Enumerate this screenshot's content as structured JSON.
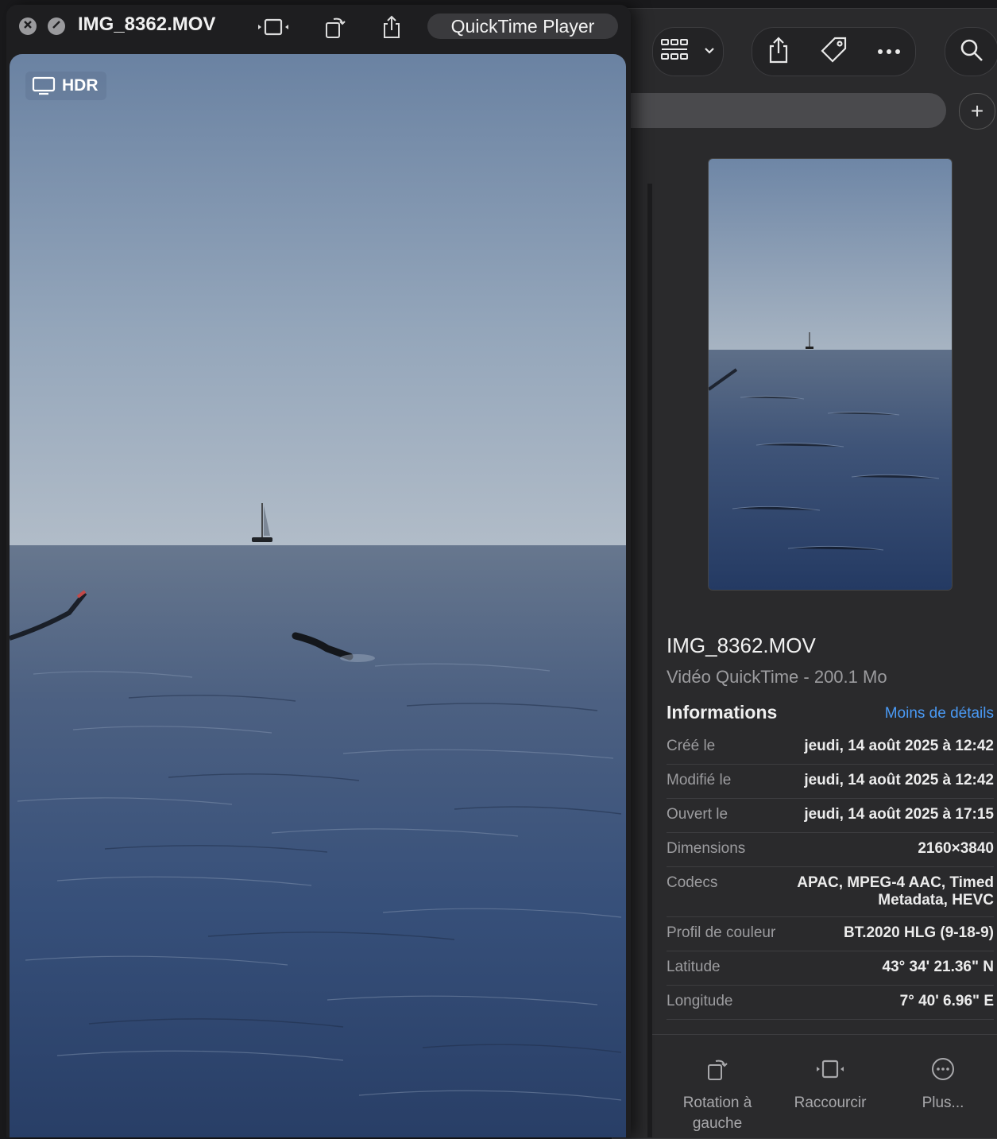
{
  "quicktime": {
    "title": "IMG_8362.MOV",
    "open_with_label": "QuickTime Player",
    "hdr_badge": "HDR",
    "icons": [
      "close-icon",
      "minimize-icon",
      "trim-icon",
      "rotate-icon",
      "share-icon"
    ]
  },
  "finder": {
    "toolbar_icons": [
      "view-grid-icon",
      "chevron-down-icon",
      "share-icon",
      "tag-icon",
      "more-icon",
      "search-icon",
      "plus-icon"
    ],
    "file": {
      "name": "IMG_8362.MOV",
      "kind": "Vidéo QuickTime - 200.1 Mo"
    },
    "info": {
      "heading": "Informations",
      "toggle_label": "Moins de détails",
      "rows": [
        {
          "key": "Créé le",
          "value": "jeudi, 14 août 2025 à 12:42"
        },
        {
          "key": "Modifié le",
          "value": "jeudi, 14 août 2025 à 12:42"
        },
        {
          "key": "Ouvert le",
          "value": "jeudi, 14 août 2025 à 17:15"
        },
        {
          "key": "Dimensions",
          "value": "2160×3840"
        },
        {
          "key": "Codecs",
          "value": "APAC, MPEG-4 AAC, Timed Metadata, HEVC"
        },
        {
          "key": "Profil de couleur",
          "value": "BT.2020 HLG (9-18-9)"
        },
        {
          "key": "Latitude",
          "value": "43° 34' 21.36\" N"
        },
        {
          "key": "Longitude",
          "value": "7° 40' 6.96\" E"
        }
      ]
    },
    "quick_actions": [
      {
        "label": "Rotation à gauche",
        "icon": "rotate-left-icon"
      },
      {
        "label": "Raccourcir",
        "icon": "trim-icon"
      },
      {
        "label": "Plus...",
        "icon": "more-circle-icon"
      }
    ]
  },
  "colors": {
    "accent": "#4a9af5",
    "window_bg": "#2a2a2c",
    "sky_top": "#6f86a3",
    "sea_deep": "#2a3b57"
  }
}
